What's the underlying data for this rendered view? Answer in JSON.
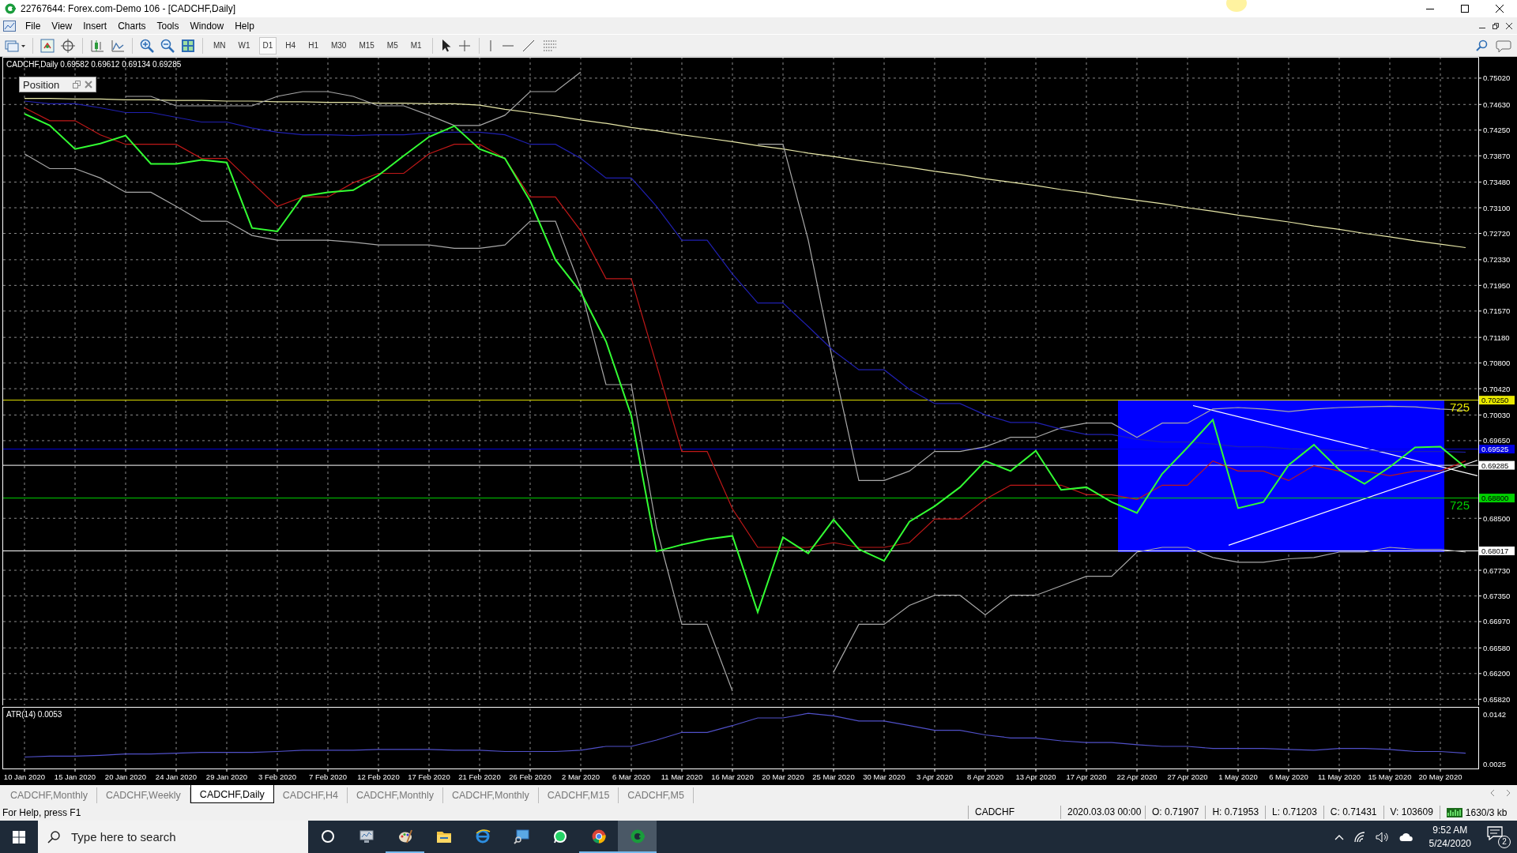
{
  "window": {
    "title": "22767644: Forex.com-Demo 106 - [CADCHF,Daily]"
  },
  "menu": [
    "File",
    "View",
    "Insert",
    "Charts",
    "Tools",
    "Window",
    "Help"
  ],
  "toolbar": {
    "periods": [
      {
        "label": "MN",
        "selected": false
      },
      {
        "label": "W1",
        "selected": false
      },
      {
        "label": "D1",
        "selected": true
      },
      {
        "label": "H4",
        "selected": false
      },
      {
        "label": "H1",
        "selected": false
      },
      {
        "label": "M30",
        "selected": false
      },
      {
        "label": "M15",
        "selected": false
      },
      {
        "label": "M5",
        "selected": false
      },
      {
        "label": "M1",
        "selected": false
      }
    ]
  },
  "chart": {
    "header": "CADCHF,Daily  0.69582 0.69612 0.69134 0.69285",
    "position_panel": {
      "title": "Position"
    },
    "chart_data": {
      "type": "line",
      "grid": true,
      "ylim": [
        0.658,
        0.753
      ],
      "yticks": [
        {
          "value": 0.7502,
          "label": "0.75020"
        },
        {
          "value": 0.7463,
          "label": "0.74630"
        },
        {
          "value": 0.7425,
          "label": "0.74250"
        },
        {
          "value": 0.7387,
          "label": "0.73870"
        },
        {
          "value": 0.7348,
          "label": "0.73480"
        },
        {
          "value": 0.731,
          "label": "0.73100"
        },
        {
          "value": 0.7272,
          "label": "0.72720"
        },
        {
          "value": 0.7233,
          "label": "0.72330"
        },
        {
          "value": 0.7195,
          "label": "0.71950"
        },
        {
          "value": 0.7157,
          "label": "0.71570"
        },
        {
          "value": 0.7118,
          "label": "0.71180"
        },
        {
          "value": 0.708,
          "label": "0.70800"
        },
        {
          "value": 0.7042,
          "label": "0.70420"
        },
        {
          "value": 0.7003,
          "label": "0.70030"
        },
        {
          "value": 0.6965,
          "label": "0.69650"
        },
        {
          "value": 0.685,
          "label": "0.68500"
        },
        {
          "value": 0.6773,
          "label": "0.67730"
        },
        {
          "value": 0.6735,
          "label": "0.67350"
        },
        {
          "value": 0.6697,
          "label": "0.66970"
        },
        {
          "value": 0.6658,
          "label": "0.66580"
        },
        {
          "value": 0.662,
          "label": "0.66200"
        },
        {
          "value": 0.6582,
          "label": "0.65820"
        }
      ],
      "ref_lines": [
        {
          "axis": "y",
          "value": 0.7025,
          "label": "0.70250",
          "color": "#e8e800"
        },
        {
          "axis": "y",
          "value": 0.69525,
          "label": "0.69525",
          "color": "#0000e0"
        },
        {
          "axis": "y",
          "value": 0.69285,
          "label": "0.69285",
          "color": "#ffffff"
        },
        {
          "axis": "y",
          "value": 0.688,
          "label": "0.68800",
          "color": "#00d000"
        },
        {
          "axis": "y",
          "value": 0.68017,
          "label": "0.68017",
          "color": "#ffffff"
        }
      ],
      "series": [
        {
          "color": "#e8e8a8",
          "values": [
            0.7472,
            0.7472,
            0.7471,
            0.7471,
            0.747,
            0.747,
            0.7469,
            0.7469,
            0.7468,
            0.7468,
            0.7467,
            0.7467,
            0.7466,
            0.7466,
            0.7465,
            0.7465,
            0.7464,
            0.7464,
            0.7462,
            0.7456,
            0.7451,
            0.7446,
            0.744,
            0.7435,
            0.7429,
            0.7424,
            0.7418,
            0.7413,
            0.7408,
            0.7402,
            0.7397,
            0.7391,
            0.7386,
            0.738,
            0.7375,
            0.737,
            0.7364,
            0.7359,
            0.7353,
            0.7348,
            0.7343,
            0.7337,
            0.7332,
            0.7326,
            0.7321,
            0.7316,
            0.731,
            0.7305,
            0.7299,
            0.7294,
            0.7289,
            0.7283,
            0.7278,
            0.7272,
            0.7267,
            0.7261,
            0.7256,
            0.7251
          ]
        },
        {
          "color": "#a8a8a8",
          "values": [
            null,
            null,
            null,
            null,
            0.7475,
            0.7475,
            0.7461,
            0.7461,
            0.7461,
            0.7461,
            0.7475,
            0.7482,
            0.7482,
            0.7475,
            0.7461,
            0.7461,
            0.7447,
            0.7432,
            0.7432,
            0.7447,
            0.7482,
            0.7482,
            0.7511,
            null,
            null,
            null,
            null,
            null,
            null,
            0.7404,
            0.7404,
            0.7262,
            0.7077,
            0.6906,
            0.6906,
            0.692,
            0.6949,
            0.6949,
            0.6956,
            0.697,
            0.697,
            0.6984,
            0.6991,
            0.6991,
            0.697,
            0.6991,
            0.6991,
            0.7012,
            0.7014,
            0.7012,
            0.7008,
            0.7012,
            0.7014,
            0.7015,
            0.7016,
            0.7015,
            0.7012,
            0.701
          ]
        },
        {
          "color": "#a8a8a8",
          "values": [
            0.739,
            0.7368,
            0.7368,
            0.7354,
            0.7333,
            0.7333,
            0.7312,
            0.729,
            0.729,
            0.7269,
            0.7262,
            0.7262,
            0.7262,
            0.7259,
            0.7255,
            0.7255,
            0.7255,
            0.725,
            0.725,
            0.7255,
            0.729,
            0.729,
            0.7191,
            0.7048,
            0.7048,
            0.6835,
            0.6693,
            0.6693,
            0.6594,
            null,
            null,
            null,
            0.6622,
            0.6693,
            0.6693,
            0.6721,
            0.6736,
            0.6736,
            0.6707,
            0.6736,
            0.6736,
            0.675,
            0.6764,
            0.6764,
            0.68,
            0.6807,
            0.6807,
            0.6792,
            0.6785,
            0.6785,
            0.679,
            0.6792,
            0.68,
            0.68,
            0.6807,
            0.6804,
            0.6804,
            0.68
          ]
        },
        {
          "color": "#2020b0",
          "values": [
            0.7468,
            0.7464,
            0.7464,
            0.7458,
            0.7451,
            0.7451,
            0.7444,
            0.7437,
            0.7437,
            0.7428,
            0.7422,
            0.7418,
            0.7418,
            0.7417,
            0.7418,
            0.7418,
            0.7421,
            0.7422,
            0.7422,
            0.7418,
            0.7404,
            0.7404,
            0.7383,
            0.7354,
            0.7354,
            0.7312,
            0.7262,
            0.7262,
            0.7212,
            0.7169,
            0.7169,
            0.7134,
            0.7098,
            0.707,
            0.707,
            0.7041,
            0.702,
            0.702,
            0.7003,
            0.6992,
            0.6992,
            0.6982,
            0.6974,
            0.6974,
            0.6967,
            0.6963,
            0.6963,
            0.696,
            0.6956,
            0.6956,
            0.6953,
            0.6952,
            0.695,
            0.695,
            0.6949,
            0.6949,
            0.6949,
            0.6948
          ]
        },
        {
          "color": "#c01818",
          "values": [
            0.7458,
            0.7439,
            0.7439,
            0.7418,
            0.7404,
            0.7404,
            0.7404,
            0.7383,
            0.7383,
            0.7347,
            0.7312,
            0.7326,
            0.7326,
            0.7347,
            0.7361,
            0.7361,
            0.739,
            0.7404,
            0.7404,
            0.7383,
            0.7326,
            0.7326,
            0.7276,
            0.7205,
            0.7205,
            0.7077,
            0.6949,
            0.6949,
            0.6864,
            0.6807,
            0.6807,
            0.6807,
            0.6814,
            0.6807,
            0.6807,
            0.6814,
            0.6849,
            0.6849,
            0.6878,
            0.6899,
            0.6899,
            0.6899,
            0.6885,
            0.6885,
            0.6878,
            0.6899,
            0.6899,
            0.6935,
            0.692,
            0.692,
            0.6906,
            0.6928,
            0.692,
            0.692,
            0.6913,
            0.692,
            0.692,
            0.6935
          ]
        },
        {
          "color": "#33ff33",
          "values": [
            0.7449,
            0.7432,
            0.7397,
            0.7405,
            0.7417,
            0.7375,
            0.7375,
            0.7381,
            0.7377,
            0.728,
            0.7275,
            0.7327,
            0.7333,
            0.7336,
            0.7358,
            0.7387,
            0.7415,
            0.7431,
            0.7397,
            0.7383,
            0.732,
            0.7233,
            0.7185,
            0.7112,
            0.7002,
            0.6801,
            0.6811,
            0.6819,
            0.6824,
            0.6711,
            0.6822,
            0.6798,
            0.6848,
            0.6804,
            0.6787,
            0.6845,
            0.6868,
            0.6896,
            0.6935,
            0.692,
            0.695,
            0.6892,
            0.6896,
            0.6874,
            0.6858,
            0.6916,
            0.6955,
            0.6996,
            0.6865,
            0.6874,
            0.6929,
            0.6959,
            0.6922,
            0.6901,
            0.6926,
            0.6955,
            0.6956,
            0.6925
          ]
        }
      ]
    },
    "object_labels": [
      {
        "text": "725",
        "color": "#e8e800"
      },
      {
        "text": "725",
        "color": "#00d000"
      }
    ]
  },
  "indicator": {
    "label": "ATR(14) 0.0053",
    "chart_data": {
      "type": "line",
      "grid": true,
      "ylim": [
        0.0014,
        0.0159
      ],
      "categories": [
        "10 Jan 2020",
        null,
        "15 Jan 2020",
        null,
        "20 Jan 2020",
        null,
        "24 Jan 2020",
        null,
        "29 Jan 2020",
        null,
        "3 Feb 2020",
        null,
        "7 Feb 2020",
        null,
        "12 Feb 2020",
        null,
        "17 Feb 2020",
        null,
        "21 Feb 2020",
        null,
        "26 Feb 2020",
        null,
        "2 Mar 2020",
        null,
        "6 Mar 2020",
        null,
        "11 Mar 2020",
        null,
        "16 Mar 2020",
        null,
        "20 Mar 2020",
        null,
        "25 Mar 2020",
        null,
        "30 Mar 2020",
        null,
        "3 Apr 2020",
        null,
        "8 Apr 2020",
        null,
        "13 Apr 2020",
        null,
        "17 Apr 2020",
        null,
        "22 Apr 2020",
        null,
        "27 Apr 2020",
        null,
        "1 May 2020",
        null,
        "6 May 2020",
        null,
        "11 May 2020",
        null,
        "15 May 2020",
        null,
        "20 May 2020",
        null
      ],
      "yticks": [
        {
          "value": 0.0142,
          "label": "0.0142"
        },
        {
          "value": 0.0025,
          "label": "0.0025"
        }
      ],
      "series": [
        {
          "color": "#5050c8",
          "values": [
            0.0041,
            0.0043,
            0.0043,
            0.0045,
            0.0048,
            0.0048,
            0.005,
            0.0052,
            0.0052,
            0.0052,
            0.0054,
            0.0057,
            0.0057,
            0.0057,
            0.0059,
            0.0059,
            0.0059,
            0.0057,
            0.0057,
            0.0054,
            0.0054,
            0.0054,
            0.0057,
            0.0066,
            0.0066,
            0.0081,
            0.0099,
            0.0099,
            0.0115,
            0.0133,
            0.0133,
            0.0144,
            0.0138,
            0.0126,
            0.0126,
            0.0115,
            0.0104,
            0.0104,
            0.0093,
            0.0086,
            0.0086,
            0.0079,
            0.0075,
            0.0075,
            0.007,
            0.0066,
            0.0066,
            0.0061,
            0.0061,
            0.0061,
            0.0059,
            0.0057,
            0.0061,
            0.0061,
            0.0059,
            0.0054,
            0.0054,
            0.005
          ]
        }
      ]
    }
  },
  "chart_tabs": [
    {
      "label": "CADCHF,Monthly",
      "selected": false
    },
    {
      "label": "CADCHF,Weekly",
      "selected": false
    },
    {
      "label": "CADCHF,Daily",
      "selected": true
    },
    {
      "label": "CADCHF,H4",
      "selected": false
    },
    {
      "label": "CADCHF,Monthly",
      "selected": false
    },
    {
      "label": "CADCHF,Monthly",
      "selected": false
    },
    {
      "label": "CADCHF,M15",
      "selected": false
    },
    {
      "label": "CADCHF,M5",
      "selected": false
    }
  ],
  "status_bar": {
    "help": "For Help, press F1",
    "fields": [
      "CADCHF",
      "2020.03.03 00:00",
      "O: 0.71907",
      "H: 0.71953",
      "L: 0.71203",
      "C: 0.71431",
      "V: 103609"
    ],
    "traffic": "1630/3 kb"
  },
  "taskbar": {
    "search": {
      "placeholder": "Type here to search"
    },
    "apps": [
      {
        "kind": "task-view",
        "running": false,
        "active": false
      },
      {
        "kind": "monitor",
        "running": false,
        "active": false
      },
      {
        "kind": "paint",
        "running": true,
        "active": false
      },
      {
        "kind": "folder",
        "running": false,
        "active": false
      },
      {
        "kind": "browser",
        "running": false,
        "active": false
      },
      {
        "kind": "remote",
        "running": false,
        "active": false
      },
      {
        "kind": "chat",
        "running": false,
        "active": false
      },
      {
        "kind": "chrome",
        "running": true,
        "active": false
      },
      {
        "kind": "trader",
        "running": true,
        "active": true
      }
    ],
    "tray": {
      "time": "9:52 AM",
      "date": "5/24/2020",
      "notifications": "2"
    }
  }
}
